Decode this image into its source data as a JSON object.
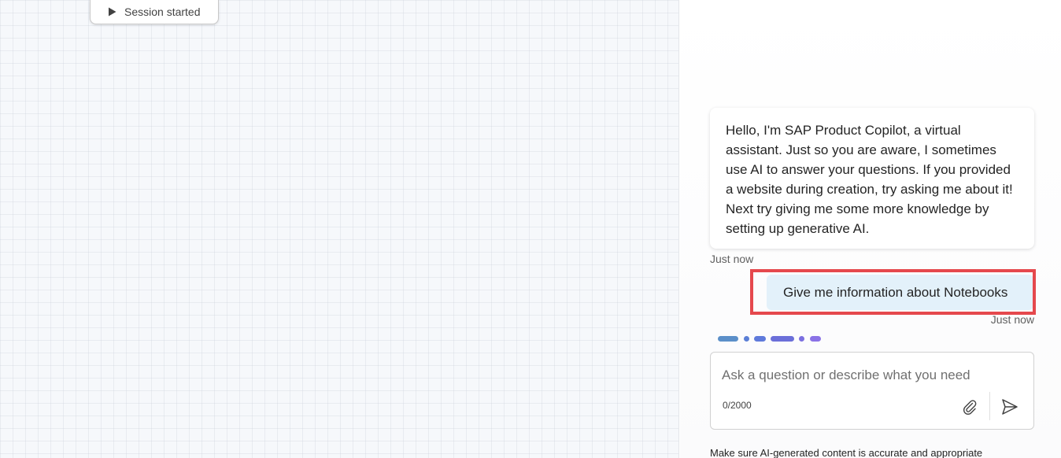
{
  "canvas": {
    "session_label": "Session started",
    "session_icon": "play-icon"
  },
  "chat": {
    "bot_message": "Hello, I'm SAP Product Copilot, a virtual assistant. Just so you are aware, I sometimes use AI to answer your questions. If you provided a website during creation, try asking me about it! Next try giving me some more knowledge by setting up generative AI.",
    "bot_timestamp": "Just now",
    "user_message": "Give me information about Notebooks",
    "user_timestamp": "Just now",
    "typing_indicator_colors": [
      "#5b8fc9",
      "#5b7fd6",
      "#6b6fd9",
      "#7b6fe0",
      "#8a72e6"
    ],
    "highlight_color": "#e5484d"
  },
  "input": {
    "placeholder": "Ask a question or describe what you need",
    "value": "",
    "char_count": "0/2000",
    "attach_icon": "paperclip-icon",
    "send_icon": "send-icon"
  },
  "footer": {
    "disclaimer": "Make sure AI-generated content is accurate and appropriate"
  }
}
